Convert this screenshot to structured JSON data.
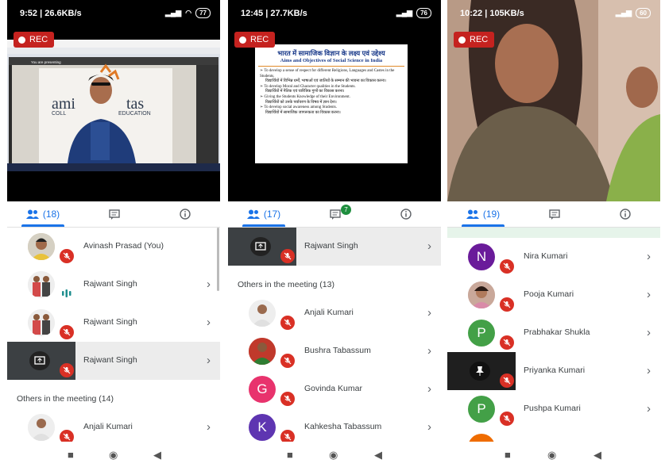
{
  "colors": {
    "rec": "#c5221f",
    "accent": "#1a73e8",
    "mic_off": "#d93025",
    "chat_badge": "#1e8e3e"
  },
  "phones": [
    {
      "status": {
        "time": "9:52 | 26.6KB/s",
        "battery": "77"
      },
      "rec_label": "REC",
      "video": {
        "slide_logo_left": "ami",
        "slide_logo_right": "tas",
        "slide_sub_left": "COLL",
        "slide_sub_right": "EDUCATION",
        "presenting_text": "You are presenting"
      },
      "tabs": {
        "people_count": "(18)"
      },
      "rows": [
        {
          "name": "Avinash Prasad (You)"
        },
        {
          "name": "Rajwant Singh"
        },
        {
          "name": "Rajwant Singh"
        },
        {
          "name": "Rajwant Singh"
        }
      ],
      "section_label": "Others in the meeting (14)",
      "rows_after": [
        {
          "name": "Anjali Kumari"
        }
      ]
    },
    {
      "status": {
        "time": "12:45 | 27.7KB/s",
        "battery": "76"
      },
      "rec_label": "REC",
      "slide": {
        "title_hindi": "भारत में सामाजिक विज्ञान के लक्ष्य एवं उद्देश्य",
        "title_en": "Aims and Objectives of Social Science in India",
        "bullets": [
          {
            "en": "To develop a sense of respect for different Religions, Languages and Castes in the Students.",
            "hi": "विद्यार्थियों में विभिन्न धर्मों, भाषाओं एवं जातियों के सम्मान की भावना का विकास करना।"
          },
          {
            "en": "To develop Moral and Character qualities in the Students.",
            "hi": "विद्यार्थियों में नैतिक एवं चारित्रिक गुणों का विकास करना।"
          },
          {
            "en": "Giving the Students Knowledge of their Environment.",
            "hi": "विद्यार्थियों को उनके पर्यावरण के विषय में ज्ञान देना।"
          },
          {
            "en": "To develop social awareness among Students.",
            "hi": "विद्यार्थियों में सामाजिक जागरूकता का विकास करना।"
          }
        ]
      },
      "tabs": {
        "people_count": "(17)",
        "chat_badge": "7"
      },
      "rows": [
        {
          "name": "Rajwant Singh"
        }
      ],
      "section_label": "Others in the meeting (13)",
      "rows_after": [
        {
          "name": "Anjali Kumari"
        },
        {
          "name": "Bushra Tabassum"
        },
        {
          "name": "Govinda Kumar",
          "initial": "G",
          "color": "#e8336d"
        },
        {
          "name": "Kahkesha Tabassum",
          "initial": "K",
          "color": "#5e35b1"
        }
      ]
    },
    {
      "status": {
        "time": "10:22 | 105KB/s",
        "battery": "60"
      },
      "rec_label": "REC",
      "tabs": {
        "people_count": "(19)"
      },
      "rows": [
        {
          "name": "Nira Kumari",
          "initial": "N",
          "color": "#6a1b9a"
        },
        {
          "name": "Pooja Kumari"
        },
        {
          "name": "Prabhakar Shukla",
          "initial": "P",
          "color": "#43a047"
        },
        {
          "name": "Priyanka Kumari"
        },
        {
          "name": "Pushpa Kumari",
          "initial": "P",
          "color": "#43a047"
        }
      ]
    }
  ]
}
